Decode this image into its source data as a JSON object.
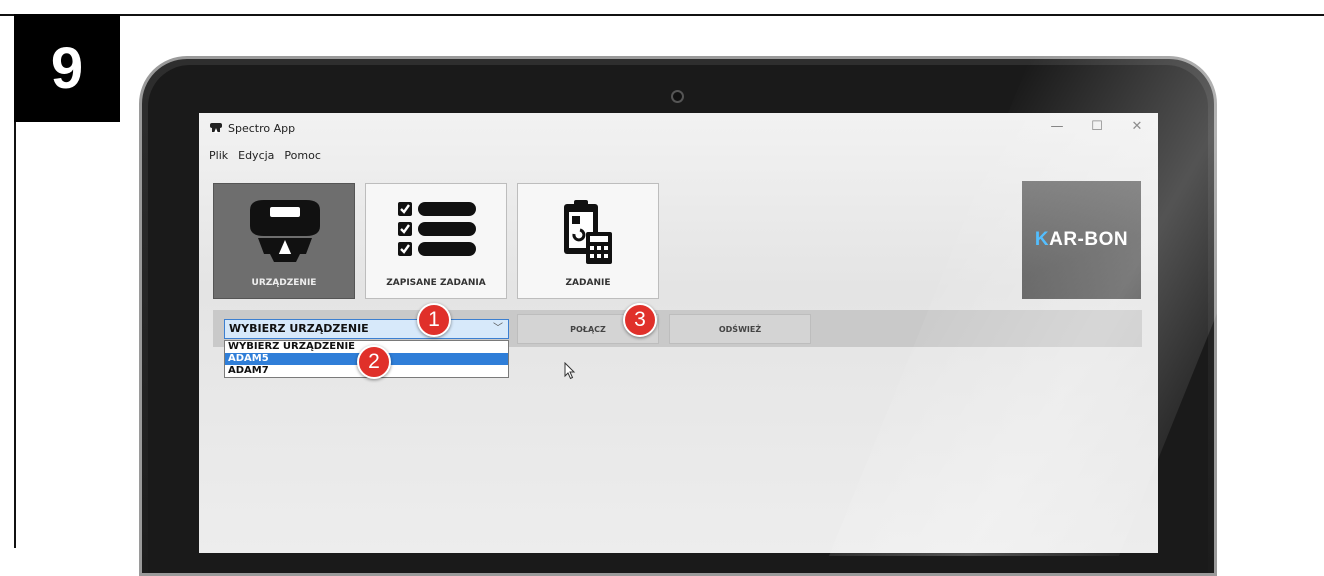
{
  "step_number": "9",
  "window": {
    "title": "Spectro App",
    "controls": {
      "minimize": "—",
      "maximize": "☐",
      "close": "✕"
    }
  },
  "menu": [
    "Plik",
    "Edycja",
    "Pomoc"
  ],
  "tiles": [
    {
      "label": "URZĄDZENIE",
      "icon": "device-icon",
      "active": true
    },
    {
      "label": "ZAPISANE ZADANIA",
      "icon": "checklist-icon",
      "active": false
    },
    {
      "label": "ZADANIE",
      "icon": "clipboard-calculator-icon",
      "active": false
    }
  ],
  "logo": {
    "prefix": "K",
    "text": "AR-BON"
  },
  "device_select": {
    "value": "WYBIERZ URZĄDZENIE",
    "options": [
      "WYBIERZ URZĄDZENIE",
      "ADAM5",
      "ADAM7"
    ],
    "highlighted": "ADAM5"
  },
  "buttons": {
    "connect": "POŁĄCZ",
    "refresh": "ODŚWIEŻ"
  },
  "markers": [
    "1",
    "2",
    "3"
  ],
  "colors": {
    "marker_red": "#e0302a",
    "selection_blue": "#2f7ed8",
    "logo_accent": "#3ab5ff"
  }
}
